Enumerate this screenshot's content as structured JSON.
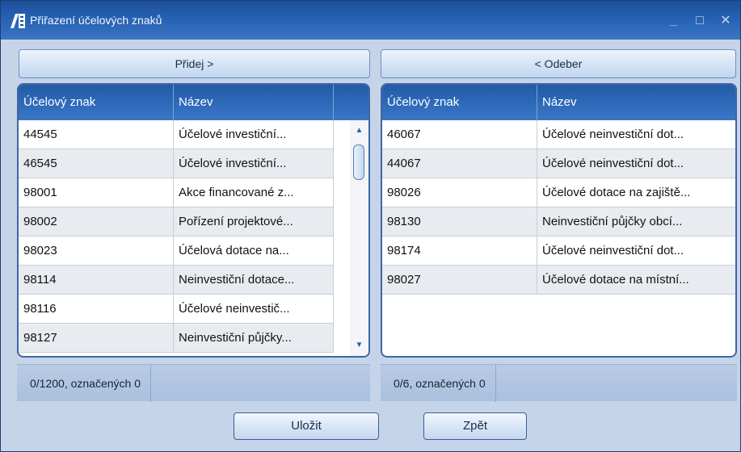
{
  "window": {
    "title": "Přiřazení účelových znaků",
    "minimize": "_",
    "maximize": "□",
    "close": "✕"
  },
  "toolbar": {
    "add_label": "Přidej  >",
    "remove_label": "<  Odeber"
  },
  "left_table": {
    "columns": [
      "Účelový znak",
      "Název"
    ],
    "rows": [
      {
        "code": "44545",
        "name": "Účelové investiční..."
      },
      {
        "code": "46545",
        "name": "Účelové investiční..."
      },
      {
        "code": "98001",
        "name": "Akce financované z..."
      },
      {
        "code": "98002",
        "name": "Pořízení projektové..."
      },
      {
        "code": "98023",
        "name": "Účelová dotace na..."
      },
      {
        "code": "98114",
        "name": "Neinvestiční dotace..."
      },
      {
        "code": "98116",
        "name": "Účelové neinvestič..."
      },
      {
        "code": "98127",
        "name": "Neinvestiční půjčky..."
      }
    ],
    "status": "0/1200, označených 0",
    "scroll": {
      "up_icon": "▲",
      "down_icon": "▼"
    }
  },
  "right_table": {
    "columns": [
      "Účelový znak",
      "Název"
    ],
    "rows": [
      {
        "code": "46067",
        "name": "Účelové neinvestiční dot..."
      },
      {
        "code": "44067",
        "name": "Účelové neinvestiční dot..."
      },
      {
        "code": "98026",
        "name": "Účelové dotace na zajiště..."
      },
      {
        "code": "98130",
        "name": "Neinvestiční půjčky obcí..."
      },
      {
        "code": "98174",
        "name": "Účelové neinvestiční dot..."
      },
      {
        "code": "98027",
        "name": "Účelové dotace na místní..."
      }
    ],
    "status": "0/6, označených 0"
  },
  "footer": {
    "save_label": "Uložit",
    "back_label": "Zpět"
  },
  "colors": {
    "titlebar": "#2561b4",
    "header": "#2d69b9",
    "window_bg": "#c5d4e8"
  }
}
